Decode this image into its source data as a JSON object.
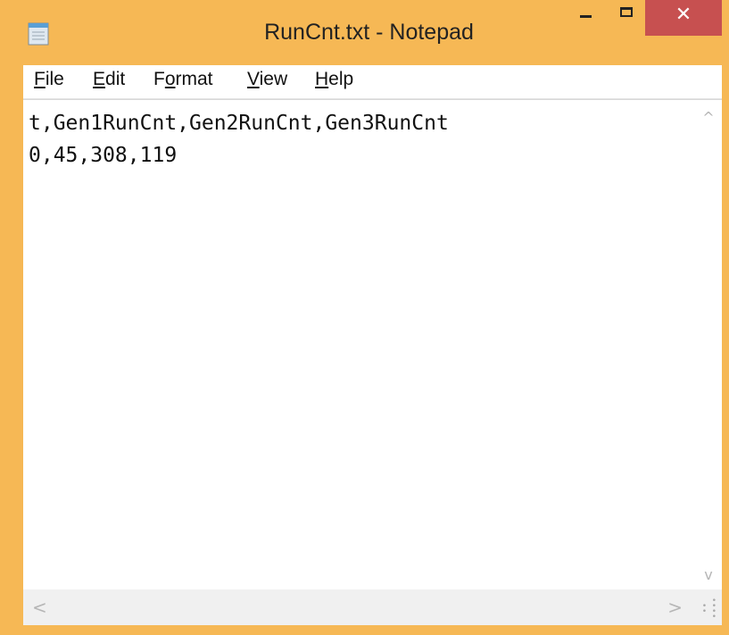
{
  "window": {
    "title": "RunCnt.txt - Notepad",
    "icon": "notepad-icon",
    "controls": {
      "minimize_icon": "minimize-icon",
      "maximize_icon": "maximize-icon",
      "close_glyph": "✕"
    },
    "frame_color": "#f6b855",
    "close_color": "#c75050"
  },
  "menu": {
    "file": {
      "pre": "",
      "key": "F",
      "post": "ile"
    },
    "edit": {
      "pre": "",
      "key": "E",
      "post": "dit"
    },
    "format": {
      "pre": "F",
      "key": "o",
      "post": "rmat"
    },
    "view": {
      "pre": "",
      "key": "V",
      "post": "iew"
    },
    "help": {
      "pre": "",
      "key": "H",
      "post": "elp"
    }
  },
  "editor": {
    "lines": [
      "t,Gen1RunCnt,Gen2RunCnt,Gen3RunCnt",
      "0,45,308,119"
    ]
  },
  "scrollbars": {
    "up_arrow": "^",
    "down_arrow": "v",
    "left_arrow": "<",
    "right_arrow": ">"
  }
}
